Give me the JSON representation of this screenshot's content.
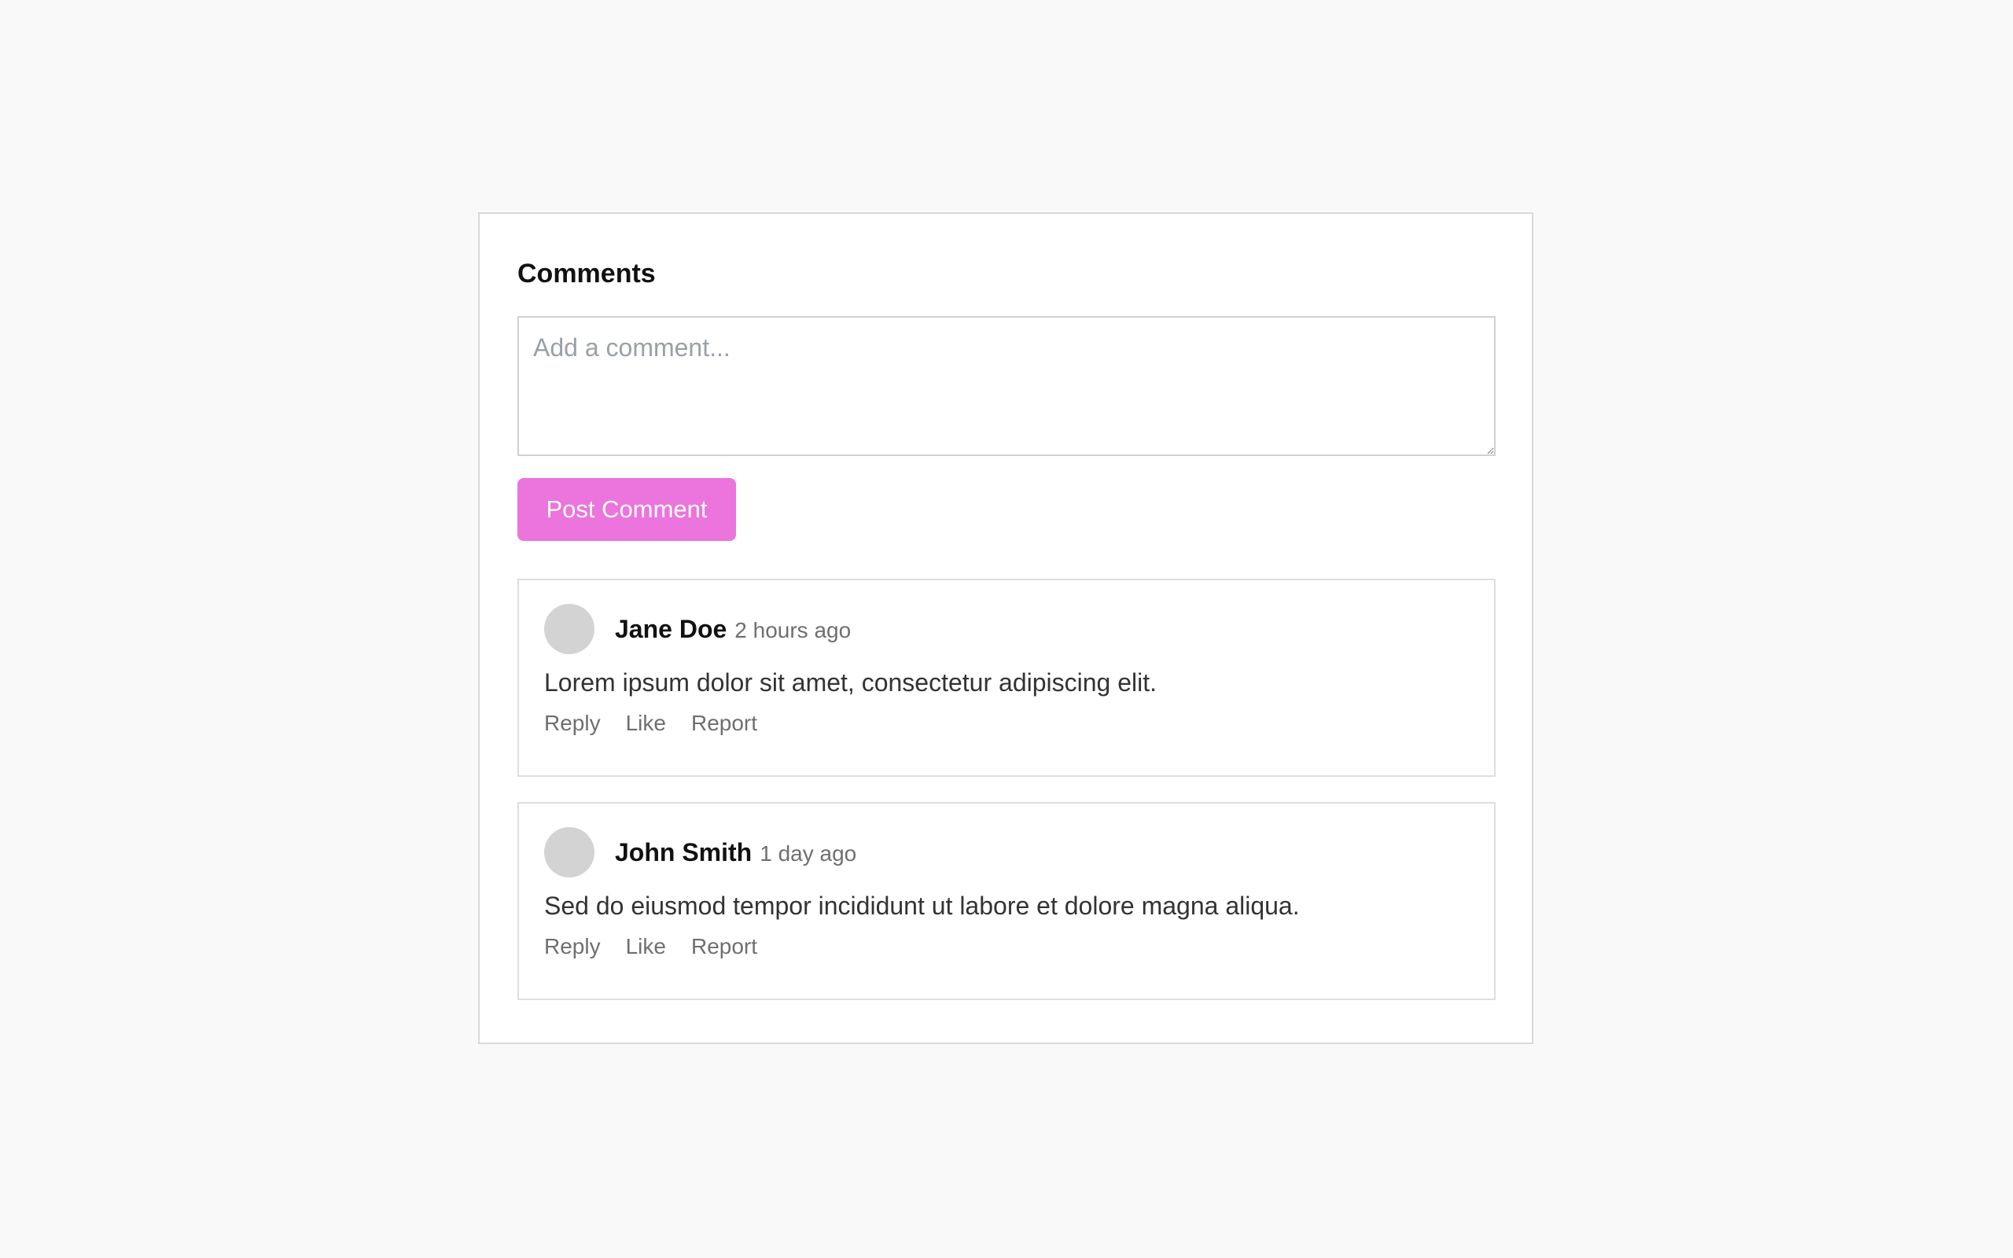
{
  "comments_section": {
    "title": "Comments",
    "input_placeholder": "Add a comment...",
    "input_value": "",
    "post_button_label": "Post Comment",
    "post_button_color": "#eb74dd"
  },
  "comments": [
    {
      "author": "Jane Doe",
      "time": "2 hours ago",
      "text": "Lorem ipsum dolor sit amet, consectetur adipiscing elit.",
      "actions": [
        "Reply",
        "Like",
        "Report"
      ]
    },
    {
      "author": "John Smith",
      "time": "1 day ago",
      "text": "Sed do eiusmod tempor incididunt ut labore et dolore magna aliqua.",
      "actions": [
        "Reply",
        "Like",
        "Report"
      ]
    }
  ]
}
